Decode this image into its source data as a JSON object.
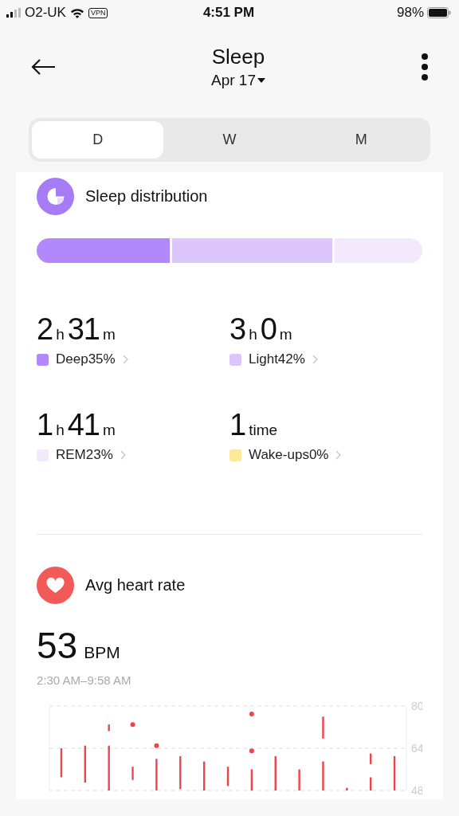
{
  "status_bar": {
    "carrier": "O2-UK",
    "vpn": "VPN",
    "time": "4:51 PM",
    "battery": "98%"
  },
  "header": {
    "title": "Sleep",
    "date": "Apr 17"
  },
  "tabs": [
    {
      "label": "D",
      "selected": true
    },
    {
      "label": "W",
      "selected": false
    },
    {
      "label": "M",
      "selected": false
    }
  ],
  "sleep_distribution": {
    "title": "Sleep distribution",
    "bar": [
      {
        "color": "#b388fb"
      },
      {
        "color": "#dcc6fc"
      },
      {
        "color": "#f3e9fd"
      }
    ],
    "stats": [
      {
        "value": [
          {
            "number": "2",
            "unit": "h"
          },
          {
            "number": "31",
            "unit": "m"
          }
        ],
        "label": "Deep35%",
        "color": "#b388fb"
      },
      {
        "value": [
          {
            "number": "3",
            "unit": "h"
          },
          {
            "number": "0",
            "unit": "m"
          }
        ],
        "label": "Light42%",
        "color": "#dcc6fc"
      },
      {
        "value": [
          {
            "number": "1",
            "unit": "h"
          },
          {
            "number": "41",
            "unit": "m"
          }
        ],
        "label": "REM23%",
        "color": "#f3e9fd"
      },
      {
        "value": [
          {
            "number": "1",
            "unit": "time"
          }
        ],
        "label": "Wake-ups0%",
        "color": "#fce99a"
      }
    ]
  },
  "heart_rate": {
    "title": "Avg heart rate",
    "value": "53",
    "unit": "BPM",
    "range": "2:30 AM–9:58 AM",
    "chart_ticks": [
      "80",
      "64",
      "48"
    ]
  }
}
